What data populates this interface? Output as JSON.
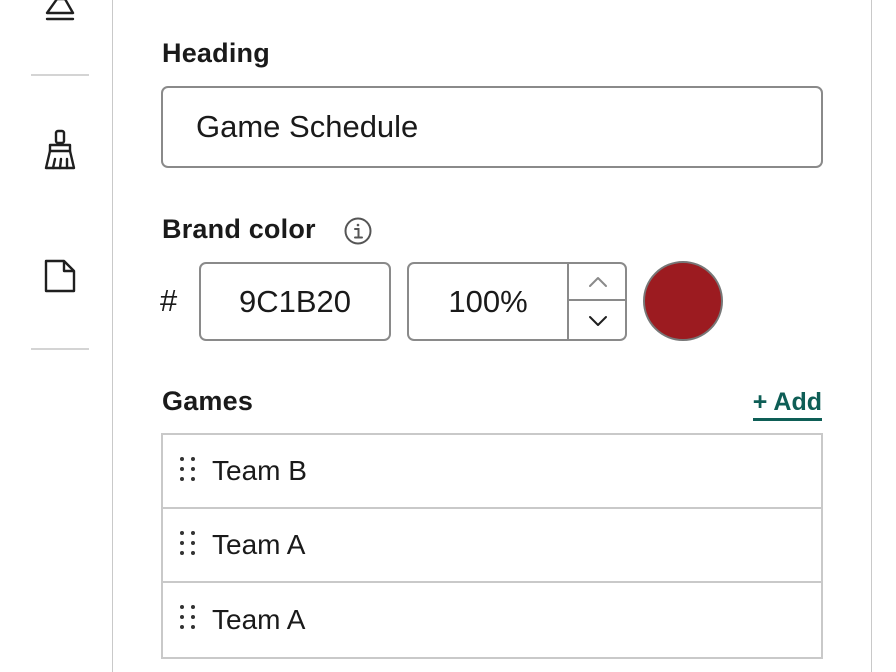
{
  "rail": {
    "icons": [
      "eraser-icon",
      "brush-icon",
      "file-icon"
    ]
  },
  "heading": {
    "label": "Heading",
    "value": "Game Schedule"
  },
  "brand_color": {
    "label": "Brand color",
    "hash": "#",
    "hex_value": "9C1B20",
    "opacity": "100%",
    "swatch_color": "#9C1B20"
  },
  "games": {
    "label": "Games",
    "add_label": "+ Add",
    "items": [
      {
        "name": "Team B"
      },
      {
        "name": "Team A"
      },
      {
        "name": "Team A"
      }
    ]
  },
  "colors": {
    "accent": "#0E5E56"
  }
}
